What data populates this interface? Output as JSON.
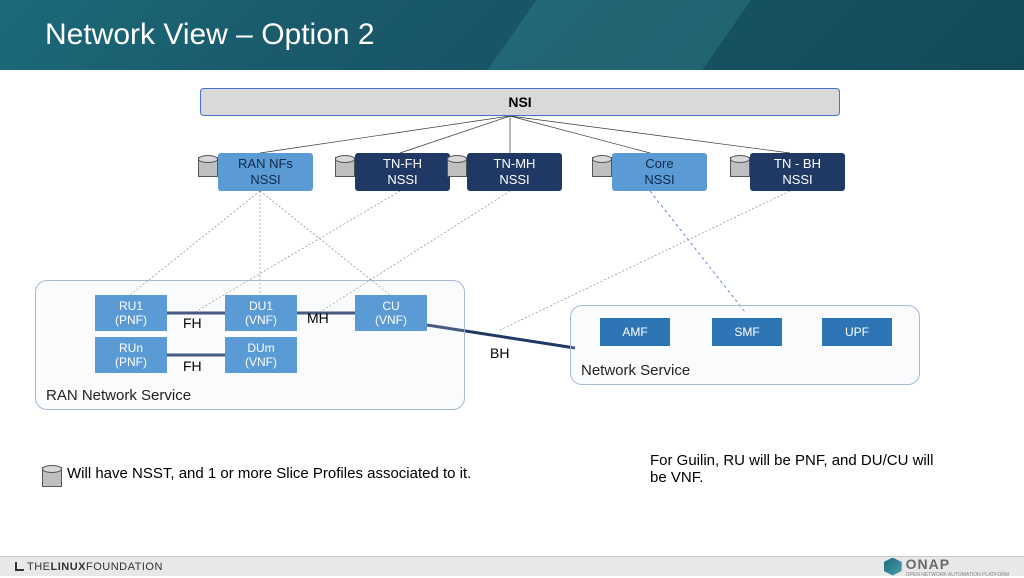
{
  "title": "Network View – Option 2",
  "nsi": "NSI",
  "nssi": {
    "ran": {
      "line1": "RAN NFs",
      "line2": "NSSI"
    },
    "tnfh": {
      "line1": "TN-FH",
      "line2": "NSSI"
    },
    "tnmh": {
      "line1": "TN-MH",
      "line2": "NSSI"
    },
    "core": {
      "line1": "Core",
      "line2": "NSSI"
    },
    "tnbh": {
      "line1": "TN - BH",
      "line2": "NSSI"
    }
  },
  "ran_group_label": "RAN Network Service",
  "ns_group_label": "Network Service",
  "nodes": {
    "ru1": {
      "l1": "RU1",
      "l2": "(PNF)"
    },
    "run": {
      "l1": "RUn",
      "l2": "(PNF)"
    },
    "du1": {
      "l1": "DU1",
      "l2": "(VNF)"
    },
    "dum": {
      "l1": "DUm",
      "l2": "(VNF)"
    },
    "cu": {
      "l1": "CU",
      "l2": "(VNF)"
    },
    "amf": "AMF",
    "smf": "SMF",
    "upf": "UPF"
  },
  "labels": {
    "fh1": "FH",
    "fh2": "FH",
    "mh": "MH",
    "bh": "BH"
  },
  "note1": "Will have NSST, and 1 or more Slice Profiles associated to it.",
  "note2": "For Guilin, RU will be PNF, and DU/CU will be VNF.",
  "footer": {
    "lf1": "THE",
    "lf2": "LINUX",
    "lf3": "FOUNDATION",
    "onap": "ONAP",
    "onap_sub": "OPEN NETWORK AUTOMATION PLATFORM"
  }
}
